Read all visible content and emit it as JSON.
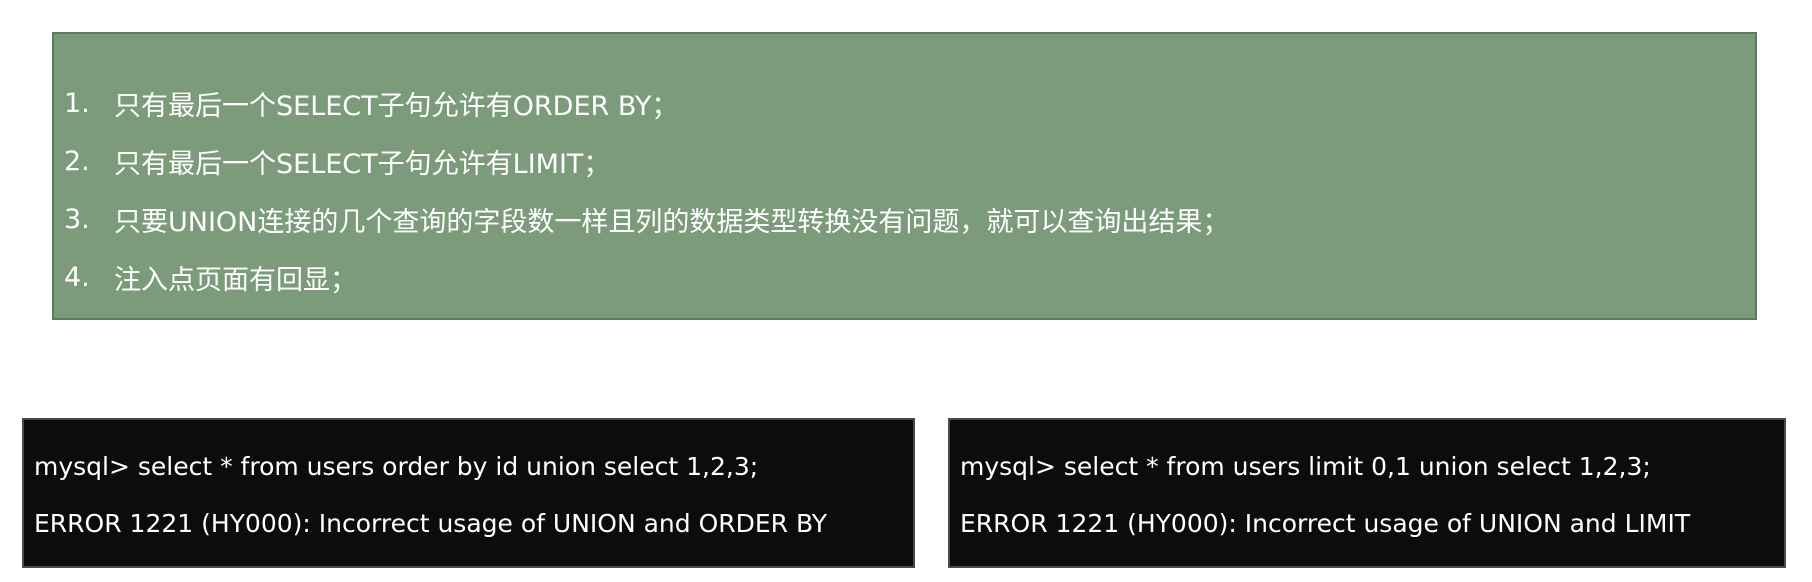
{
  "rules": {
    "items": [
      {
        "num": "1.",
        "text": "只有最后一个SELECT子句允许有ORDER BY；"
      },
      {
        "num": "2.",
        "text": "只有最后一个SELECT子句允许有LIMIT；"
      },
      {
        "num": "3.",
        "text": "只要UNION连接的几个查询的字段数一样且列的数据类型转换没有问题，就可以查询出结果；"
      },
      {
        "num": "4.",
        "text": "注入点页面有回显；"
      }
    ]
  },
  "terminals": {
    "left": {
      "command": "mysql> select * from users order by id union select 1,2,3;",
      "error": "ERROR 1221 (HY000): Incorrect usage of UNION and ORDER BY"
    },
    "right": {
      "command": "mysql> select * from users limit 0,1 union select 1,2,3;",
      "error": "ERROR 1221 (HY000): Incorrect usage of UNION and LIMIT"
    }
  },
  "colors": {
    "rules_background": "#7b9b7b",
    "terminal_background": "#0c0c0c",
    "text": "#ffffff"
  }
}
